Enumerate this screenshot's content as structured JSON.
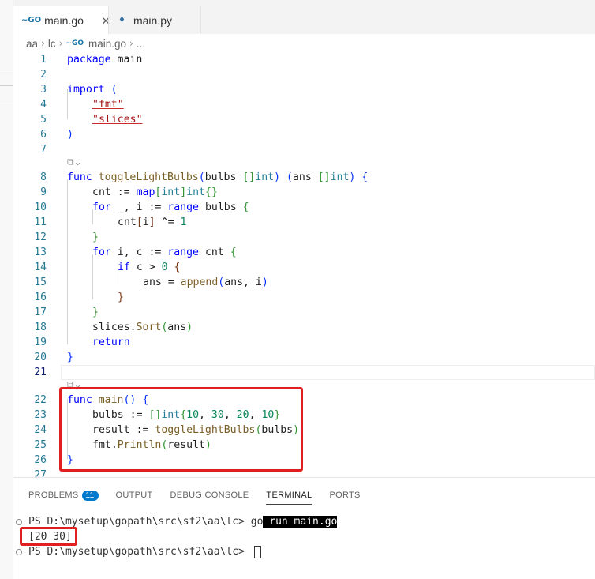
{
  "tabs": [
    {
      "label": "main.go",
      "icon": "go-file-icon",
      "close": "×"
    },
    {
      "label": "main.py",
      "icon": "python-file-icon"
    }
  ],
  "breadcrumb": [
    "aa",
    "lc",
    "main.go",
    "..."
  ],
  "code_lines": [
    {
      "n": "1",
      "text": "package main"
    },
    {
      "n": "2",
      "text": ""
    },
    {
      "n": "3",
      "text": "import ("
    },
    {
      "n": "4",
      "text": "\"fmt\""
    },
    {
      "n": "5",
      "text": "\"slices\""
    },
    {
      "n": "6",
      "text": ")"
    },
    {
      "n": "7",
      "text": ""
    },
    {
      "n": "8",
      "text": "func toggleLightBulbs(bulbs []int) (ans []int) {"
    },
    {
      "n": "9",
      "text": "cnt := map[int]int{}"
    },
    {
      "n": "10",
      "text": "for _, i := range bulbs {"
    },
    {
      "n": "11",
      "text": "cnt[i] ^= 1"
    },
    {
      "n": "12",
      "text": "}"
    },
    {
      "n": "13",
      "text": "for i, c := range cnt {"
    },
    {
      "n": "14",
      "text": "if c > 0 {"
    },
    {
      "n": "15",
      "text": "ans = append(ans, i)"
    },
    {
      "n": "16",
      "text": "}"
    },
    {
      "n": "17",
      "text": "}"
    },
    {
      "n": "18",
      "text": "slices.Sort(ans)"
    },
    {
      "n": "19",
      "text": "return"
    },
    {
      "n": "20",
      "text": "}"
    },
    {
      "n": "21",
      "text": ""
    },
    {
      "n": "22",
      "text": "func main() {"
    },
    {
      "n": "23",
      "text": "bulbs := []int{10, 30, 20, 10}"
    },
    {
      "n": "24",
      "text": "result := toggleLightBulbs(bulbs)"
    },
    {
      "n": "25",
      "text": "fmt.Println(result)"
    },
    {
      "n": "26",
      "text": "}"
    },
    {
      "n": "27",
      "text": ""
    }
  ],
  "panel": {
    "tabs": [
      "PROBLEMS",
      "OUTPUT",
      "DEBUG CONSOLE",
      "TERMINAL",
      "PORTS"
    ],
    "problems_count": "11",
    "active_tab": "TERMINAL"
  },
  "terminal": {
    "prompt1": "PS D:\\mysetup\\gopath\\src\\sf2\\aa\\lc> ",
    "cmd_go": "go",
    "cmd_rest": " run main.go",
    "output": "[20 30]",
    "prompt2": "PS D:\\mysetup\\gopath\\src\\sf2\\aa\\lc> "
  },
  "colors": {
    "highlight_box": "#e02020",
    "keyword": "#0000ff",
    "function": "#795e26",
    "string": "#a31515",
    "number": "#098658"
  }
}
